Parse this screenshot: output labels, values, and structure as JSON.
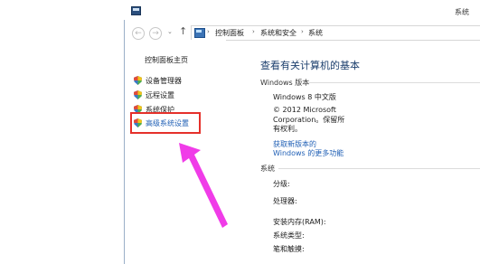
{
  "window": {
    "title": "系统"
  },
  "address_bar": {
    "back_glyph": "←",
    "forward_glyph": "→",
    "dropdown_glyph": "⌄",
    "up_glyph": "↑",
    "icon": "control-panel-icon",
    "crumbs": [
      "控制面板",
      "系统和安全",
      "系统"
    ],
    "separator": "›"
  },
  "left_pane": {
    "home_link": "控制面板主页",
    "items": [
      {
        "label": "设备管理器",
        "icon": "shield-icon"
      },
      {
        "label": "远程设置",
        "icon": "shield-icon"
      },
      {
        "label": "系统保护",
        "icon": "shield-icon"
      },
      {
        "label": "高级系统设置",
        "icon": "shield-icon"
      }
    ],
    "highlight_color": "#e5302a"
  },
  "main": {
    "title": "查看有关计算机的基本",
    "windows_section": {
      "title": "Windows 版本",
      "edition": "Windows 8 中文版",
      "copyright_line1": "© 2012 Microsoft",
      "copyright_line2": "Corporation。保留所",
      "copyright_line3": "有权利。",
      "more_line1": "获取新版本的",
      "more_line2": "Windows 的更多功能"
    },
    "system_section": {
      "title": "系统",
      "rating_label": "分级:",
      "processor_label": "处理器:",
      "ram_label": "安装内存(RAM):",
      "type_label": "系统类型:",
      "pen_label": "笔和触摸:"
    }
  },
  "annotation": {
    "arrow_color": "#f03ce8"
  },
  "colors": {
    "link": "#1f5fb5",
    "title_blue": "#1c3f6d"
  }
}
